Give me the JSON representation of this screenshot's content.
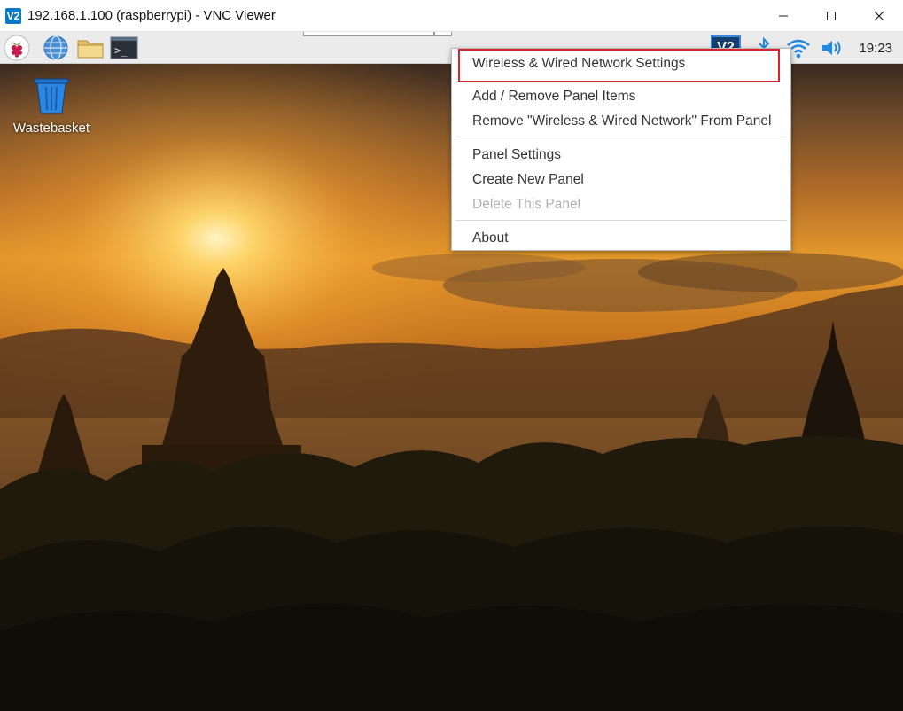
{
  "window": {
    "app_icon_text": "V2",
    "title": "192.168.1.100 (raspberrypi) - VNC Viewer",
    "buttons": [
      "minimize-icon",
      "maximize-icon",
      "close-icon"
    ]
  },
  "panel": {
    "launchers": [
      "raspberry-menu-icon",
      "web-browser-icon",
      "file-manager-icon",
      "terminal-icon"
    ],
    "terminal_glyph": ">_",
    "tray": [
      "vnc-icon",
      "bluetooth-icon",
      "wifi-icon",
      "volume-icon"
    ],
    "vnc_glyph": "V2",
    "clock": "19:23"
  },
  "desktop": {
    "icons": [
      {
        "label": "Wastebasket",
        "icon": "trash-icon"
      }
    ]
  },
  "context_menu": {
    "items": [
      {
        "label": "Wireless & Wired Network Settings",
        "enabled": true,
        "highlighted": true
      },
      {
        "label": "Add / Remove Panel Items",
        "enabled": true
      },
      {
        "label": "Remove \"Wireless & Wired Network\" From Panel",
        "enabled": true
      },
      {
        "label": "Panel Settings",
        "enabled": true
      },
      {
        "label": "Create New Panel",
        "enabled": true
      },
      {
        "label": "Delete This Panel",
        "enabled": false
      },
      {
        "label": "About",
        "enabled": true
      }
    ],
    "highlight_color": "#d9232d"
  },
  "colors": {
    "titlebar": "#ffffff",
    "panel": "#ebebeb",
    "accent": "#0a78c8"
  }
}
